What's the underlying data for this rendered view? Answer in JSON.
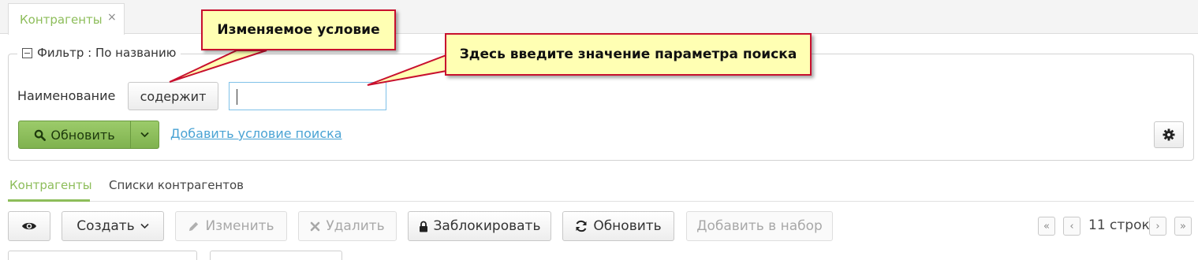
{
  "window_tab": {
    "label": "Контрагенты",
    "close": "×"
  },
  "filter": {
    "legend": "Фильтр : По названию",
    "field_label": "Наименование",
    "condition_button": "содержит",
    "search_value": "",
    "refresh_label": "Обновить",
    "add_condition_link": "Добавить условие поиска"
  },
  "subtabs": [
    {
      "label": "Контрагенты",
      "active": true
    },
    {
      "label": "Списки контрагентов",
      "active": false
    }
  ],
  "toolbar": {
    "create": "Создать",
    "edit": "Изменить",
    "delete": "Удалить",
    "block": "Заблокировать",
    "refresh": "Обновить",
    "add_to_set": "Добавить в набор"
  },
  "pager": {
    "rows_text": "11 строк",
    "first": "«",
    "prev": "‹",
    "next": "›",
    "last": "»"
  },
  "callouts": {
    "condition": "Изменяемое условие",
    "search_value": "Здесь введите значение параметра поиска"
  },
  "colors": {
    "accent_green": "#8dbd5a",
    "link_blue": "#4aa3d4",
    "callout_border": "#c8102e",
    "callout_fill": "#ffffb3"
  }
}
